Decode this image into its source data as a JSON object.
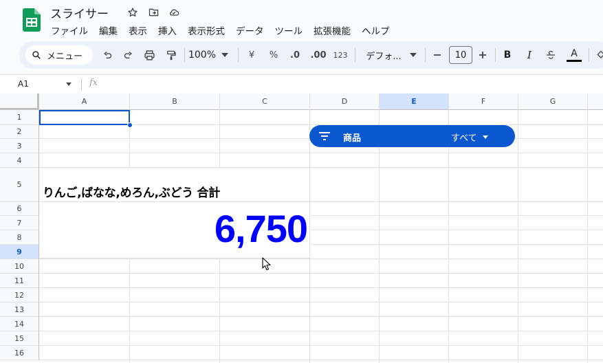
{
  "app": {
    "title": "スライサー",
    "menu": [
      "ファイル",
      "編集",
      "表示",
      "挿入",
      "表示形式",
      "データ",
      "ツール",
      "拡張機能",
      "ヘルプ"
    ]
  },
  "toolbar": {
    "search_label": "メニュー",
    "zoom": "100%",
    "currency": "¥",
    "percent": "%",
    "decrease_decimal": ".0",
    "increase_decimal": ".00",
    "number_format": "123",
    "font": "デフォ...",
    "font_size": "10",
    "bold": "B",
    "italic": "I",
    "text_color": "A"
  },
  "formula_bar": {
    "name_box": "A1",
    "fx": "fx"
  },
  "columns": [
    "A",
    "B",
    "C",
    "D",
    "E",
    "F",
    "G"
  ],
  "rows": [
    "1",
    "2",
    "3",
    "4",
    "5",
    "6",
    "7",
    "8",
    "9",
    "10",
    "11",
    "12",
    "13",
    "14",
    "15",
    "16"
  ],
  "selected_column": "E",
  "selected_row": "9",
  "cells": {
    "label": "りんご,ばなな,めろん,ぶどう 合計",
    "total": "6,750"
  },
  "slicer": {
    "label": "商品",
    "value": "すべて"
  },
  "colors": {
    "accent": "#0b57d0",
    "total_text": "#0000ff",
    "selection_header": "#d3e3fd"
  }
}
